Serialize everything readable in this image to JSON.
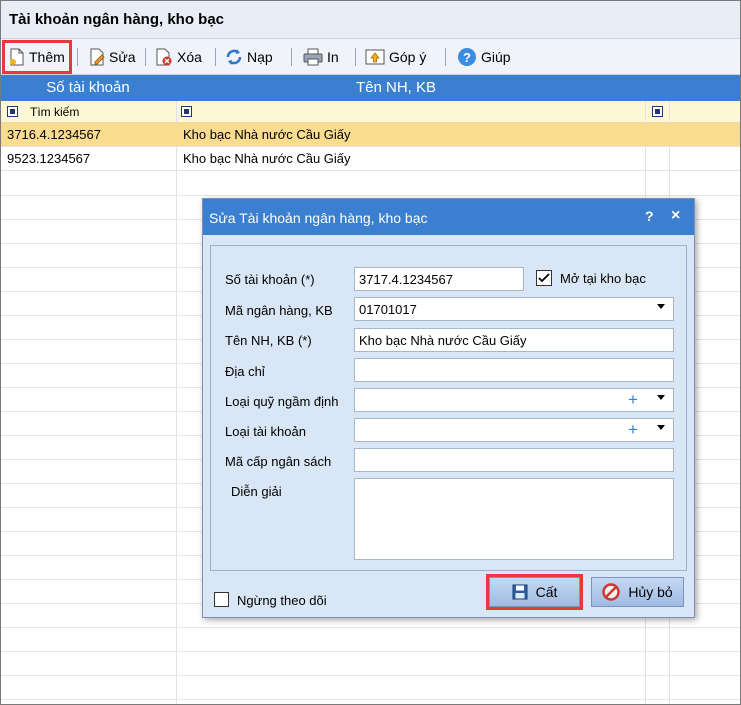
{
  "window": {
    "title": "Tài khoản ngân hàng, kho bạc"
  },
  "toolbar": {
    "add_label": "Thêm",
    "edit_label": "Sửa",
    "delete_label": "Xóa",
    "reload_label": "Nạp",
    "print_label": "In",
    "feedback_label": "Góp ý",
    "help_label": "Giúp"
  },
  "grid": {
    "columns": [
      "Số tài khoản",
      "Tên NH, KB"
    ],
    "search_label": "Tìm kiếm",
    "rows": [
      {
        "account_no": "3716.4.1234567",
        "bank_name": "Kho bạc Nhà nước Cầu Giấy",
        "selected": true
      },
      {
        "account_no": "9523.1234567",
        "bank_name": "Kho bạc Nhà nước Cầu Giấy",
        "selected": false
      }
    ]
  },
  "dialog": {
    "title": "Sửa Tài khoản ngân hàng, kho bạc",
    "help_glyph": "?",
    "close_glyph": "×",
    "fields": {
      "account_no_label": "Số tài khoản (*)",
      "account_no_value": "3717.4.1234567",
      "treasury_checkbox_label": "Mở tại kho bạc",
      "treasury_checked": true,
      "bank_code_label": "Mã ngân hàng, KB",
      "bank_code_value": "01701017",
      "bank_name_label": "Tên NH, KB (*)",
      "bank_name_value": "Kho bạc Nhà nước Cầu Giấy",
      "address_label": "Địa chỉ",
      "address_value": "",
      "fund_type_label": "Loại quỹ ngầm định",
      "fund_type_value": "",
      "account_type_label": "Loại tài khoản",
      "account_type_value": "",
      "budget_level_label": "Mã cấp ngân sách",
      "budget_level_value": "",
      "description_label": "Diễn giải",
      "description_value": ""
    },
    "stop_tracking_label": "Ngừng theo dõi",
    "stop_tracking_checked": false,
    "save_label": "Cất",
    "cancel_label": "Hủy bỏ"
  },
  "colors": {
    "header_blue": "#3a7fd0",
    "selected_row": "#f9dc8f",
    "filter_row": "#fdf7d3",
    "highlight_red": "#e8383b",
    "dialog_body": "#d9e6f6"
  },
  "icons": {
    "add": "new-file-icon",
    "edit": "edit-pencil-icon",
    "delete": "delete-file-icon",
    "reload": "refresh-icon",
    "print": "printer-icon",
    "feedback": "feedback-icon",
    "help": "help-circle-icon",
    "save": "floppy-disk-icon",
    "cancel": "cancel-icon"
  }
}
